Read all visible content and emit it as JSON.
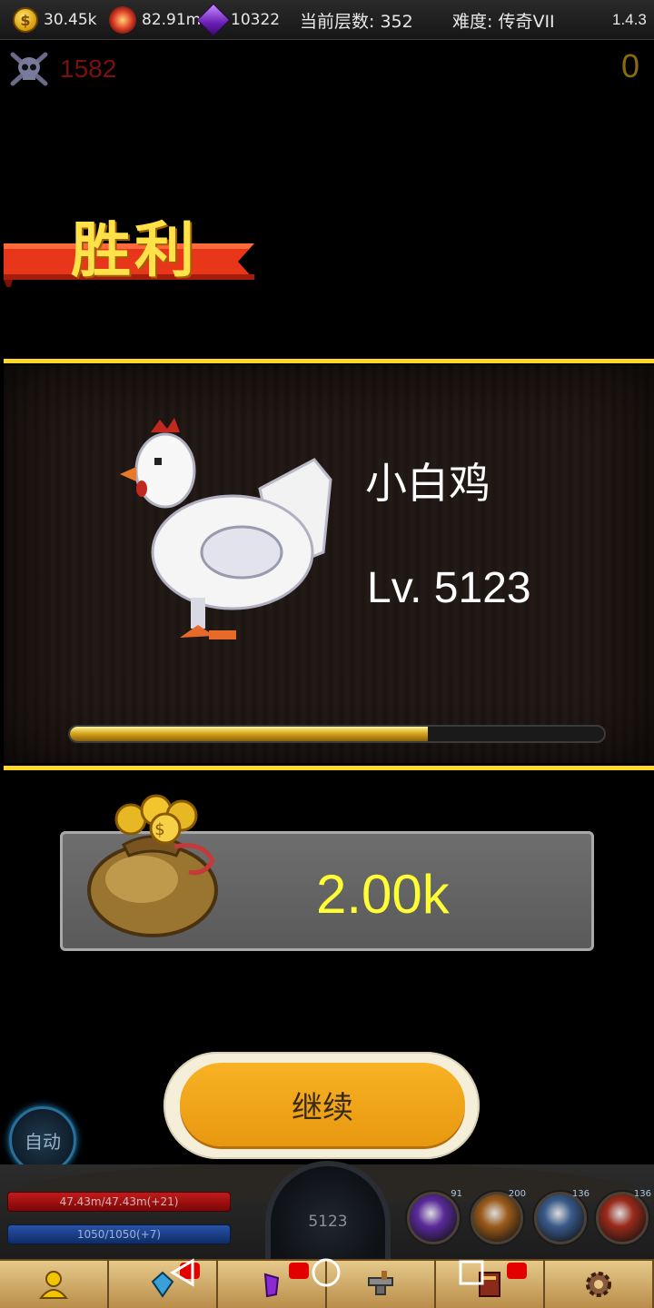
{
  "status_bar": {
    "gold": "30.45k",
    "power": "82.91m",
    "gems": "10322",
    "floor_label": "当前层数: 352",
    "difficulty_label": "难度: 传奇VII",
    "version": "1.4.3",
    "coin_symbol": "$"
  },
  "kills": {
    "count": "1582",
    "right_count": "0"
  },
  "victory": {
    "title": "胜利"
  },
  "monster": {
    "name": "小白鸡",
    "level": "Lv. 5123",
    "xp_fraction": 0.67
  },
  "reward": {
    "amount": "2.00k"
  },
  "buttons": {
    "continue_label": "继续",
    "auto_label": "自动"
  },
  "hud": {
    "hp": "47.43m/47.43m(+21)",
    "mp": "1050/1050(+7)",
    "player_level": "5123",
    "skills": [
      {
        "name": "skill-void",
        "level": "91",
        "color": "#5a2a9a"
      },
      {
        "name": "skill-holy-cross",
        "level": "200",
        "color": "#9a5a1a"
      },
      {
        "name": "skill-ice-rock",
        "level": "136",
        "color": "#3a5a8a"
      },
      {
        "name": "skill-berserk",
        "level": "136",
        "color": "#9a2a1a"
      }
    ]
  },
  "tabs": [
    {
      "name": "tab-character",
      "icon": "person-icon"
    },
    {
      "name": "tab-equipment",
      "icon": "gem-icon"
    },
    {
      "name": "tab-skills",
      "icon": "crystal-icon"
    },
    {
      "name": "tab-forge",
      "icon": "anvil-icon"
    },
    {
      "name": "tab-quests",
      "icon": "book-icon"
    },
    {
      "name": "tab-settings",
      "icon": "gear-icon"
    }
  ],
  "colors": {
    "accent_yellow": "#ffd82a",
    "victory_text": "#ffe14a",
    "ribbon_red": "#e8361b",
    "button_orange": "#f0a21a",
    "reward_text": "#ffff33"
  }
}
